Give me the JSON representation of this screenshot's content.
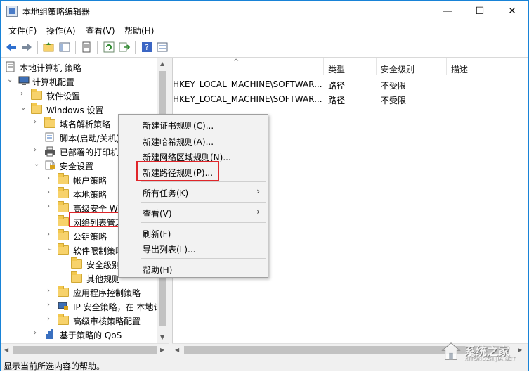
{
  "window": {
    "title": "本地组策略编辑器",
    "minimize": "—",
    "maximize": "☐",
    "close": "✕"
  },
  "menubar": [
    "文件(F)",
    "操作(A)",
    "查看(V)",
    "帮助(H)"
  ],
  "toolbar": [
    "back-icon",
    "forward-icon",
    "up-folder-icon",
    "show-tree-icon",
    "properties-icon",
    "refresh-icon",
    "export-list-icon",
    "help-icon",
    "view-icon"
  ],
  "tree": [
    {
      "label": "本地计算机 策略",
      "icon": "policy-icon"
    },
    {
      "label": "计算机配置",
      "icon": "computer-icon"
    },
    {
      "label": "软件设置",
      "icon": "folder-icon"
    },
    {
      "label": "Windows 设置",
      "icon": "folder-icon"
    },
    {
      "label": "域名解析策略",
      "icon": "folder-icon"
    },
    {
      "label": "脚本(启动/关机)",
      "icon": "script-icon"
    },
    {
      "label": "已部署的打印机",
      "icon": "printer-icon"
    },
    {
      "label": "安全设置",
      "icon": "security-icon"
    },
    {
      "label": "帐户策略",
      "icon": "folder-lock-icon"
    },
    {
      "label": "本地策略",
      "icon": "folder-lock-icon"
    },
    {
      "label": "高级安全 Windows",
      "icon": "folder-icon"
    },
    {
      "label": "网络列表管理器",
      "icon": "folder-icon"
    },
    {
      "label": "公钥策略",
      "icon": "folder-icon"
    },
    {
      "label": "软件限制策略",
      "icon": "folder-icon"
    },
    {
      "label": "安全级别",
      "icon": "folder-icon"
    },
    {
      "label": "其他规则",
      "icon": "folder-icon"
    },
    {
      "label": "应用程序控制策略",
      "icon": "folder-icon"
    },
    {
      "label": "IP 安全策略，在 本地计算机",
      "icon": "ipsec-icon"
    },
    {
      "label": "高级审核策略配置",
      "icon": "folder-icon"
    },
    {
      "label": "基于策略的 QoS",
      "icon": "chart-icon"
    }
  ],
  "list": {
    "columns": [
      "类型",
      "安全级别",
      "描述"
    ],
    "rows": [
      {
        "name": "HKEY_LOCAL_MACHINE\\SOFTWAR...",
        "type": "路径",
        "level": "不受限",
        "desc": ""
      },
      {
        "name": "HKEY_LOCAL_MACHINE\\SOFTWAR...",
        "type": "路径",
        "level": "不受限",
        "desc": ""
      }
    ]
  },
  "context_menu": {
    "items": [
      {
        "label": "新建证书规则(C)..."
      },
      {
        "label": "新建哈希规则(A)..."
      },
      {
        "label": "新建网络区域规则(N)..."
      },
      {
        "label": "新建路径规则(P)...",
        "highlighted": true
      },
      {
        "label": "所有任务(K)",
        "submenu": "›"
      },
      {
        "label": "查看(V)",
        "submenu": "›"
      },
      {
        "label": "刷新(F)"
      },
      {
        "label": "导出列表(L)..."
      },
      {
        "label": "帮助(H)"
      }
    ]
  },
  "status": "显示当前所选内容的帮助。",
  "watermark": {
    "text": "系统之家",
    "sub": "XITONGZHIJIA.NET"
  },
  "colors": {
    "accent": "#1883d7",
    "highlight_box": "#e0262a",
    "folder": "#f7d26b"
  }
}
